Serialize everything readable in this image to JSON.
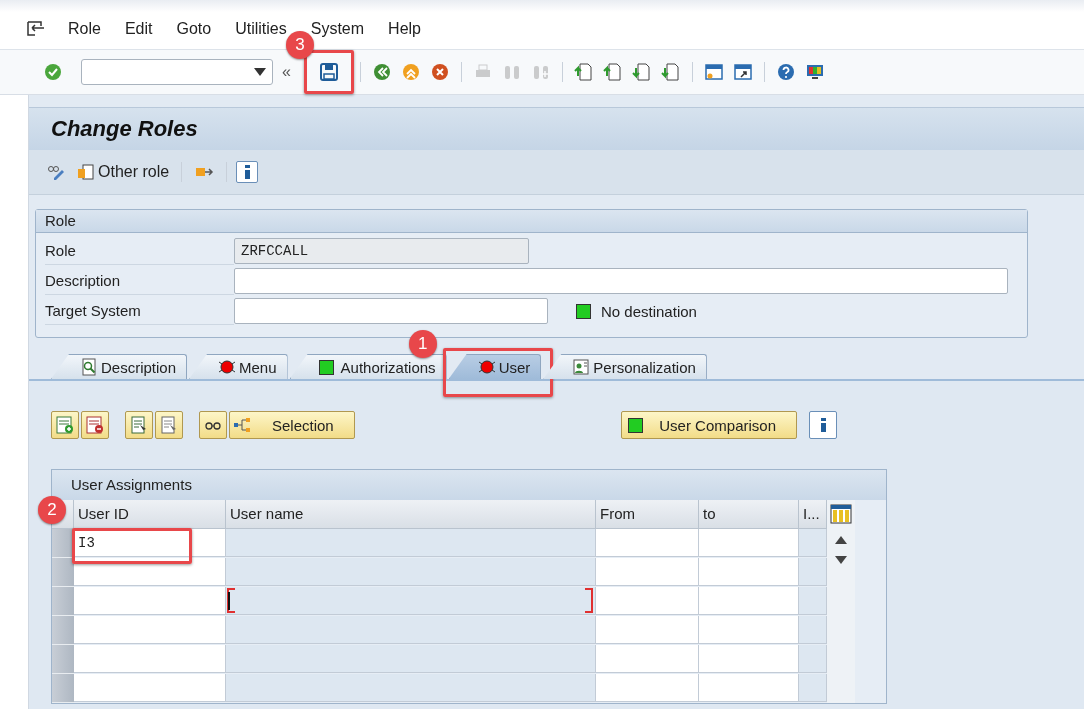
{
  "menu_bar": {
    "items": [
      "Role",
      "Edit",
      "Goto",
      "Utilities",
      "System",
      "Help"
    ]
  },
  "toolbar": {
    "items": [
      {
        "kind": "enter",
        "disabled": false
      },
      {
        "kind": "command_field"
      },
      {
        "kind": "collapse",
        "label": "«"
      },
      {
        "kind": "save",
        "disabled": false,
        "callout": "3"
      },
      {
        "kind": "separator"
      },
      {
        "kind": "back",
        "disabled": false
      },
      {
        "kind": "exit",
        "disabled": false
      },
      {
        "kind": "cancel",
        "disabled": false
      },
      {
        "kind": "separator"
      },
      {
        "kind": "print",
        "disabled": true
      },
      {
        "kind": "find",
        "disabled": true
      },
      {
        "kind": "find-next",
        "disabled": true
      },
      {
        "kind": "separator"
      },
      {
        "kind": "first-page",
        "disabled": false
      },
      {
        "kind": "prev-page",
        "disabled": false
      },
      {
        "kind": "next-page",
        "disabled": false
      },
      {
        "kind": "last-page",
        "disabled": false
      },
      {
        "kind": "separator"
      },
      {
        "kind": "new-session",
        "disabled": false
      },
      {
        "kind": "shortcut",
        "disabled": false
      },
      {
        "kind": "separator"
      },
      {
        "kind": "help",
        "disabled": false
      },
      {
        "kind": "layout",
        "disabled": false
      }
    ]
  },
  "title": "Change Roles",
  "app_toolbar": {
    "items": [
      {
        "kind": "display-change"
      },
      {
        "kind": "other",
        "label": "Other role"
      },
      {
        "kind": "separator"
      },
      {
        "kind": "transport"
      },
      {
        "kind": "separator"
      },
      {
        "kind": "info"
      }
    ]
  },
  "role_group": {
    "title": "Role",
    "fields": [
      {
        "label": "Role",
        "value": "ZRFCCALL",
        "disabled": true
      },
      {
        "label": "Description",
        "disabled": false
      },
      {
        "label": "Target System",
        "disabled": false,
        "status": {
          "color": "#22cc22",
          "text": "No destination"
        }
      }
    ]
  },
  "tabs": [
    {
      "label": "Description",
      "kind": "icon",
      "selected": false
    },
    {
      "label": "Menu",
      "kind": "light",
      "color": "#ee0000",
      "selected": false
    },
    {
      "label": "Authorizations",
      "kind": "square",
      "color": "#22cc22",
      "selected": false
    },
    {
      "label": "User",
      "kind": "light",
      "color": "#ee0000",
      "selected": true,
      "callout": "1"
    },
    {
      "label": "Personalization",
      "kind": "icon",
      "selected": false
    }
  ],
  "user_toolbar": {
    "items": [
      {
        "kind": "insert-row"
      },
      {
        "kind": "delete-row"
      },
      {
        "kind": "gap"
      },
      {
        "kind": "select-all"
      },
      {
        "kind": "deselect-all"
      },
      {
        "kind": "gap"
      },
      {
        "kind": "details"
      },
      {
        "kind": "selection",
        "label": "Selection"
      },
      {
        "kind": "spacer"
      },
      {
        "kind": "comparison",
        "label": "User Comparison",
        "color": "#22cc22"
      },
      {
        "kind": "info"
      }
    ]
  },
  "table": {
    "title": "User Assignments",
    "columns": [
      {
        "label": "User ID",
        "editable": true,
        "callout": "2"
      },
      {
        "label": "User name",
        "editable": false
      },
      {
        "label": "From",
        "editable": true
      },
      {
        "label": "to",
        "editable": true
      },
      {
        "label": "I...",
        "editable": false
      }
    ],
    "rows": [
      {
        "cells": [
          "I3",
          "",
          "",
          "",
          ""
        ],
        "focused": false
      },
      {
        "cells": [
          "",
          "",
          "",
          "",
          ""
        ],
        "focused": false
      },
      {
        "cells": [
          "",
          "",
          "",
          "",
          ""
        ],
        "focused": true
      },
      {
        "cells": [
          "",
          "",
          "",
          "",
          ""
        ],
        "focused": false
      },
      {
        "cells": [
          "",
          "",
          "",
          "",
          ""
        ],
        "focused": false
      },
      {
        "cells": [
          "",
          "",
          "",
          "",
          ""
        ],
        "focused": false
      }
    ]
  }
}
